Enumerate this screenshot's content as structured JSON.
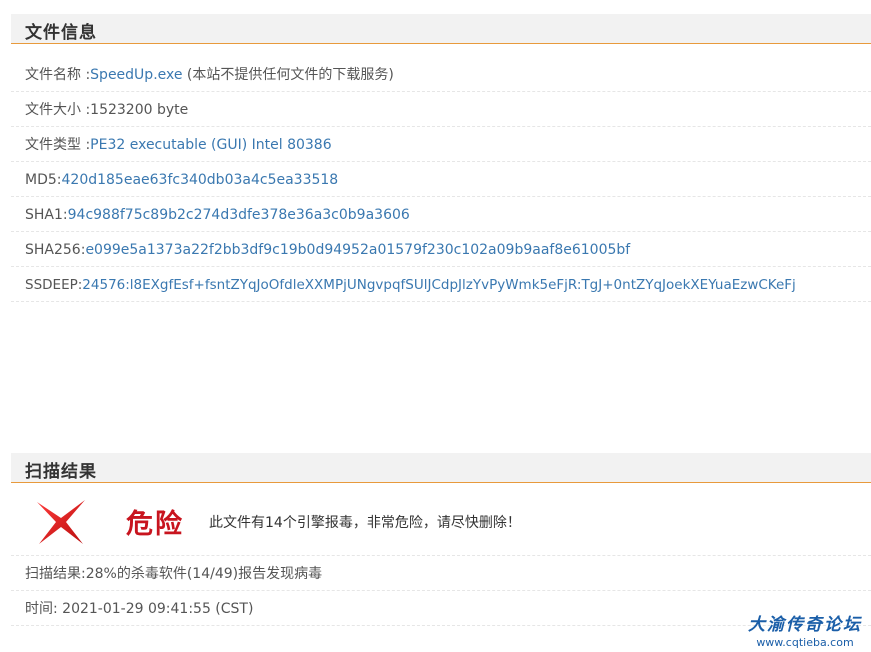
{
  "file_info": {
    "title": "文件信息",
    "rows": [
      {
        "label": "文件名称",
        "sep": " :",
        "value": "SpeedUp.exe",
        "note": "  (本站不提供任何文件的下载服务)"
      },
      {
        "label": "文件大小",
        "sep": " :",
        "value": "1523200 byte"
      },
      {
        "label": "文件类型",
        "sep": " :",
        "value": "PE32 executable (GUI) Intel 80386"
      },
      {
        "label": "MD5",
        "sep": ":",
        "value": "420d185eae63fc340db03a4c5ea33518"
      },
      {
        "label": "SHA1",
        "sep": ":",
        "value": "94c988f75c89b2c274d3dfe378e36a3c0b9a3606"
      },
      {
        "label": "SHA256",
        "sep": ":",
        "value": "e099e5a1373a22f2bb3df9c19b0d94952a01579f230c102a09b9aaf8e61005bf"
      },
      {
        "label": "SSDEEP",
        "sep": ":",
        "value": "24576:l8EXgfEsf+fsntZYqJoOfdleXXMPjUNgvpqfSUlJCdpJlzYvPyWmk5eFjR:TgJ+0ntZYqJoekXEYuaEzwCKeFj"
      }
    ]
  },
  "scan_result": {
    "title": "扫描结果",
    "danger_label": "危险",
    "danger_description": "此文件有14个引擎报毒，非常危险，请尽快删除！",
    "result_label": "扫描结果",
    "result_value": ":28%的杀毒软件(14/49)报告发现病毒",
    "time_label": "时间",
    "time_value": ": 2021-01-29 09:41:55 (CST)"
  },
  "watermark": {
    "title": "大渝传奇论坛",
    "url": "www.cqtieba.com"
  },
  "colors": {
    "accent_line": "#e89a3c",
    "link_value": "#3a78b0",
    "danger": "#c8141e",
    "watermark": "#1a5ea8"
  },
  "icons": [
    "red-x-icon"
  ]
}
